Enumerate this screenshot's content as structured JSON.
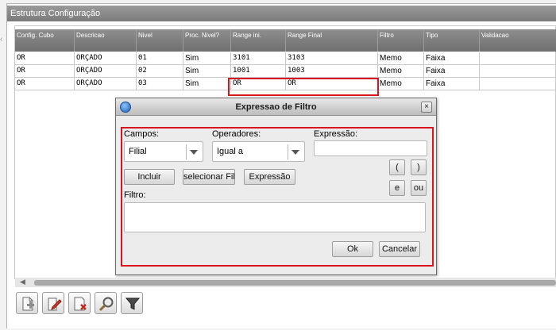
{
  "panel": {
    "title": "Estrutura Configuração"
  },
  "grid": {
    "headers": [
      "Config. Cubo",
      "Descricao",
      "Nivel",
      "Proc. Nivel?",
      "Range ini.",
      "Range Final",
      "Filtro",
      "Tipo",
      "Validacao"
    ],
    "rows": [
      [
        "OR",
        "ORÇADO",
        "01",
        "Sim",
        "3101",
        "3103",
        "Memo",
        "Faixa",
        ""
      ],
      [
        "OR",
        "ORÇADO",
        "02",
        "Sim",
        "1001",
        "1003",
        "Memo",
        "Faixa",
        ""
      ],
      [
        "OR",
        "ORÇADO",
        "03",
        "Sim",
        "OR",
        "OR",
        "Memo",
        "Faixa",
        ""
      ]
    ]
  },
  "dialog": {
    "title": "Expressao de Filtro",
    "campos_label": "Campos:",
    "campos_value": "Filial",
    "operadores_label": "Operadores:",
    "operadores_value": "Igual a",
    "expressao_label": "Expressão:",
    "expressao_value": "",
    "incluir_button": "Incluir",
    "selecionar_button": "selecionar Fil",
    "expressao_button": "Expressão",
    "open_paren_button": "(",
    "close_paren_button": ")",
    "and_button": "e",
    "or_button": "ou",
    "filtro_label": "Filtro:",
    "filtro_value": "",
    "ok_button": "Ok",
    "cancel_button": "Cancelar",
    "close_glyph": "×"
  },
  "toolbar": {
    "icons": [
      "add-document-icon",
      "edit-document-icon",
      "delete-document-icon",
      "search-icon",
      "filter-icon"
    ]
  },
  "colors": {
    "highlight": "#d9141e",
    "header_bg": "#7b7b7b",
    "dialog_bg": "#ececec"
  }
}
